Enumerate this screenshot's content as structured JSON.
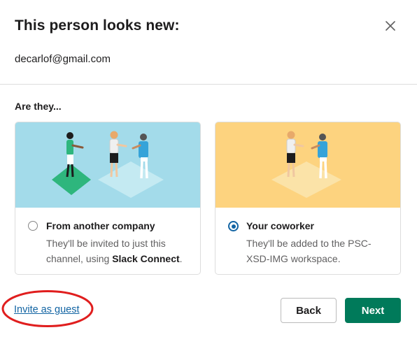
{
  "modal": {
    "title": "This person looks new:",
    "email": "decarlof@gmail.com",
    "question": "Are they...",
    "close_icon": "close-icon"
  },
  "options": [
    {
      "title": "From another company",
      "desc_prefix": "They'll be invited to just this channel, using ",
      "desc_bold": "Slack Connect",
      "desc_suffix": ".",
      "selected": false,
      "art_bg": "#a3dbea",
      "tile_color": "#2eb67d"
    },
    {
      "title": "Your coworker",
      "desc": "They'll be added to the PSC-XSD-IMG workspace.",
      "selected": true,
      "art_bg": "#fdd37f",
      "tile_color": "#fbe3a8"
    }
  ],
  "footer": {
    "invite_guest": "Invite as guest",
    "back": "Back",
    "next": "Next",
    "annotation_color": "#e01e1e"
  },
  "colors": {
    "link": "#1264a3",
    "primary": "#007a5a"
  }
}
